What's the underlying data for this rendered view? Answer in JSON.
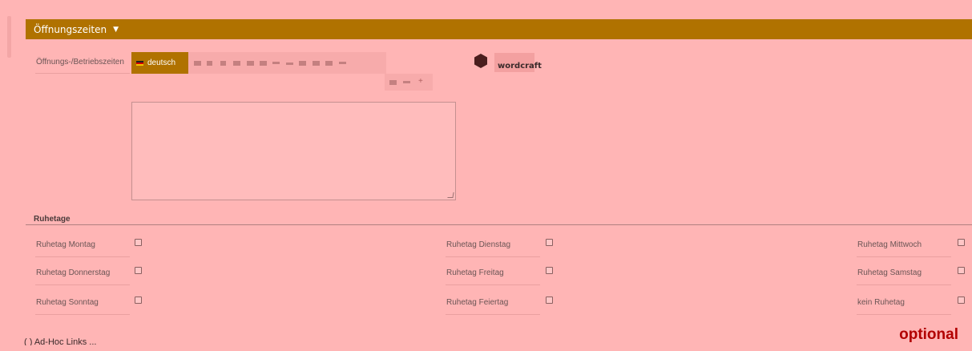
{
  "section": {
    "title": "Öffnungszeiten",
    "caret": "▼"
  },
  "hours": {
    "label": "Öffnungs-/Betriebszeiten",
    "language_tab": "deutsch",
    "add_symbol": "+",
    "textarea_value": ""
  },
  "wordcraft": {
    "logo_text": "wordcraft"
  },
  "ruhetage": {
    "title": "Ruhetage",
    "days": [
      {
        "label": "Ruhetag Montag",
        "checked": false
      },
      {
        "label": "Ruhetag Dienstag",
        "checked": false
      },
      {
        "label": "Ruhetag Mittwoch",
        "checked": false
      },
      {
        "label": "Ruhetag Donnerstag",
        "checked": false
      },
      {
        "label": "Ruhetag Freitag",
        "checked": false
      },
      {
        "label": "Ruhetag Samstag",
        "checked": false
      },
      {
        "label": "Ruhetag Sonntag",
        "checked": false
      },
      {
        "label": "Ruhetag Feiertag",
        "checked": false
      },
      {
        "label": "kein Ruhetag",
        "checked": false
      }
    ]
  },
  "badge": {
    "text": "optional"
  },
  "footer": {
    "text": "( ) Ad-Hoc Links ..."
  },
  "colors": {
    "header": "#b07200",
    "background": "#ffb5b5",
    "optional": "#b20000"
  }
}
